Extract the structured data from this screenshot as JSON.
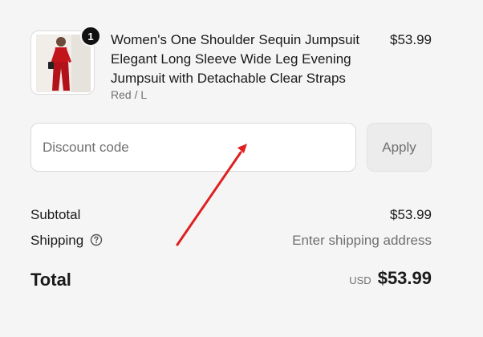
{
  "line_item": {
    "quantity": "1",
    "title": "Women's One Shoulder Sequin Jumpsuit Elegant Long Sleeve Wide Leg Evening Jumpsuit with Detachable Clear Straps",
    "variant": "Red / L",
    "price": "$53.99",
    "thumbnail_icon": "product-photo-red-jumpsuit"
  },
  "discount": {
    "placeholder": "Discount code",
    "apply_label": "Apply"
  },
  "summary": {
    "subtotal_label": "Subtotal",
    "subtotal_value": "$53.99",
    "shipping_label": "Shipping",
    "shipping_help_icon": "question-circle-icon",
    "shipping_value": "Enter shipping address",
    "total_label": "Total",
    "currency": "USD",
    "total_value": "$53.99"
  },
  "annotation": {
    "arrow_color": "#e02020"
  }
}
